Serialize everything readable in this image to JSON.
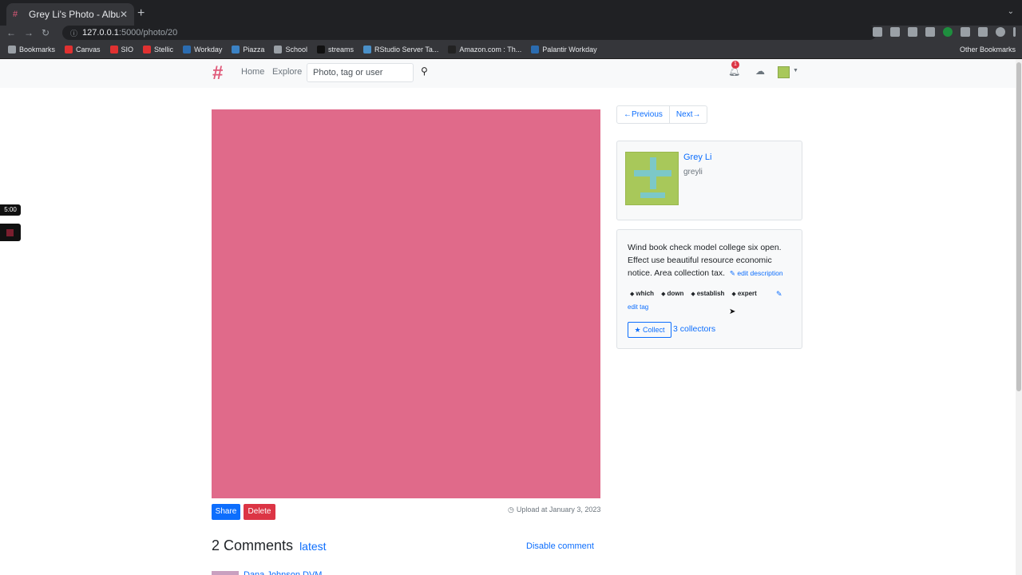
{
  "browser": {
    "tab_title": "Grey Li's Photo - Albumy",
    "tab_close": "✕",
    "new_tab": "+",
    "url_host": "127.0.0.1",
    "url_path": ":5000/photo/20",
    "bookmarks": [
      {
        "label": "Bookmarks",
        "icon": "star-icon",
        "color": "#9aa0a6"
      },
      {
        "label": "Canvas",
        "icon": "canvas-icon",
        "color": "#e03131"
      },
      {
        "label": "SIO",
        "icon": "sio-icon",
        "color": "#e03131"
      },
      {
        "label": "Stellic",
        "icon": "stellic-icon",
        "color": "#e03131"
      },
      {
        "label": "Workday",
        "icon": "workday-icon",
        "color": "#2b6cb0"
      },
      {
        "label": "Piazza",
        "icon": "piazza-icon",
        "color": "#3b82c4"
      },
      {
        "label": "School",
        "icon": "folder-icon",
        "color": "#9aa0a6"
      },
      {
        "label": "streams",
        "icon": "streams-icon",
        "color": "#111111"
      },
      {
        "label": "RStudio Server Ta...",
        "icon": "rstudio-icon",
        "color": "#4a90c8"
      },
      {
        "label": "Amazon.com : Th...",
        "icon": "amazon-icon",
        "color": "#222222"
      },
      {
        "label": "Palantir Workday",
        "icon": "workday-icon",
        "color": "#2b6cb0"
      }
    ],
    "other_bookmarks": "Other Bookmarks"
  },
  "navbar": {
    "home": "Home",
    "explore": "Explore",
    "search_placeholder": "Photo, tag or user",
    "notification_count": "1"
  },
  "photo": {
    "color": "#e06a8a",
    "share_label": "Share",
    "delete_label": "Delete",
    "upload_text": "Upload at January 3, 2023"
  },
  "comments": {
    "title": "2 Comments",
    "sort_label": "latest",
    "disable_label": "Disable comment",
    "first_author": "Dana Johnson DVM"
  },
  "pager": {
    "previous": "←Previous",
    "next": "Next→"
  },
  "user": {
    "name": "Grey Li",
    "handle": "greyli"
  },
  "description": {
    "text": "Wind book check model college six open. Effect use beautiful resource economic notice. Area collection tax.",
    "edit_label": "edit description"
  },
  "tags": {
    "items": [
      "which",
      "down",
      "establish",
      "expert"
    ],
    "edit_label": "edit tag"
  },
  "collect": {
    "button_label": "Collect",
    "collectors": "3 collectors"
  },
  "timer": {
    "time": "5:00"
  }
}
